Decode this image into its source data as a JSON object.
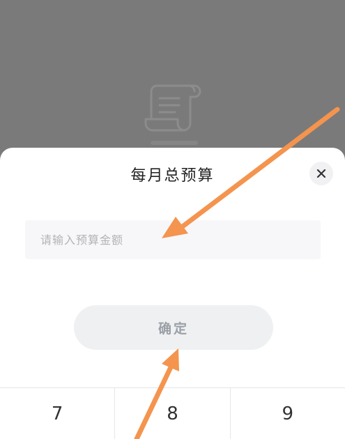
{
  "dialog": {
    "title": "每月总预算",
    "close_icon": "close-icon"
  },
  "amount_input": {
    "value": "",
    "placeholder": "请输入预算金额"
  },
  "confirm_button": {
    "label": "确定"
  },
  "keypad": {
    "keys": [
      "7",
      "8",
      "9"
    ]
  },
  "background": {
    "icon": "receipt-scroll-icon"
  },
  "annotations": {
    "arrow_color": "#f4944e"
  },
  "colors": {
    "overlay": "#7a7a7a",
    "sheet": "#ffffff",
    "input_bg": "#f7f7f9",
    "button_bg": "#eef0f2",
    "button_text": "#9aa0a6"
  }
}
